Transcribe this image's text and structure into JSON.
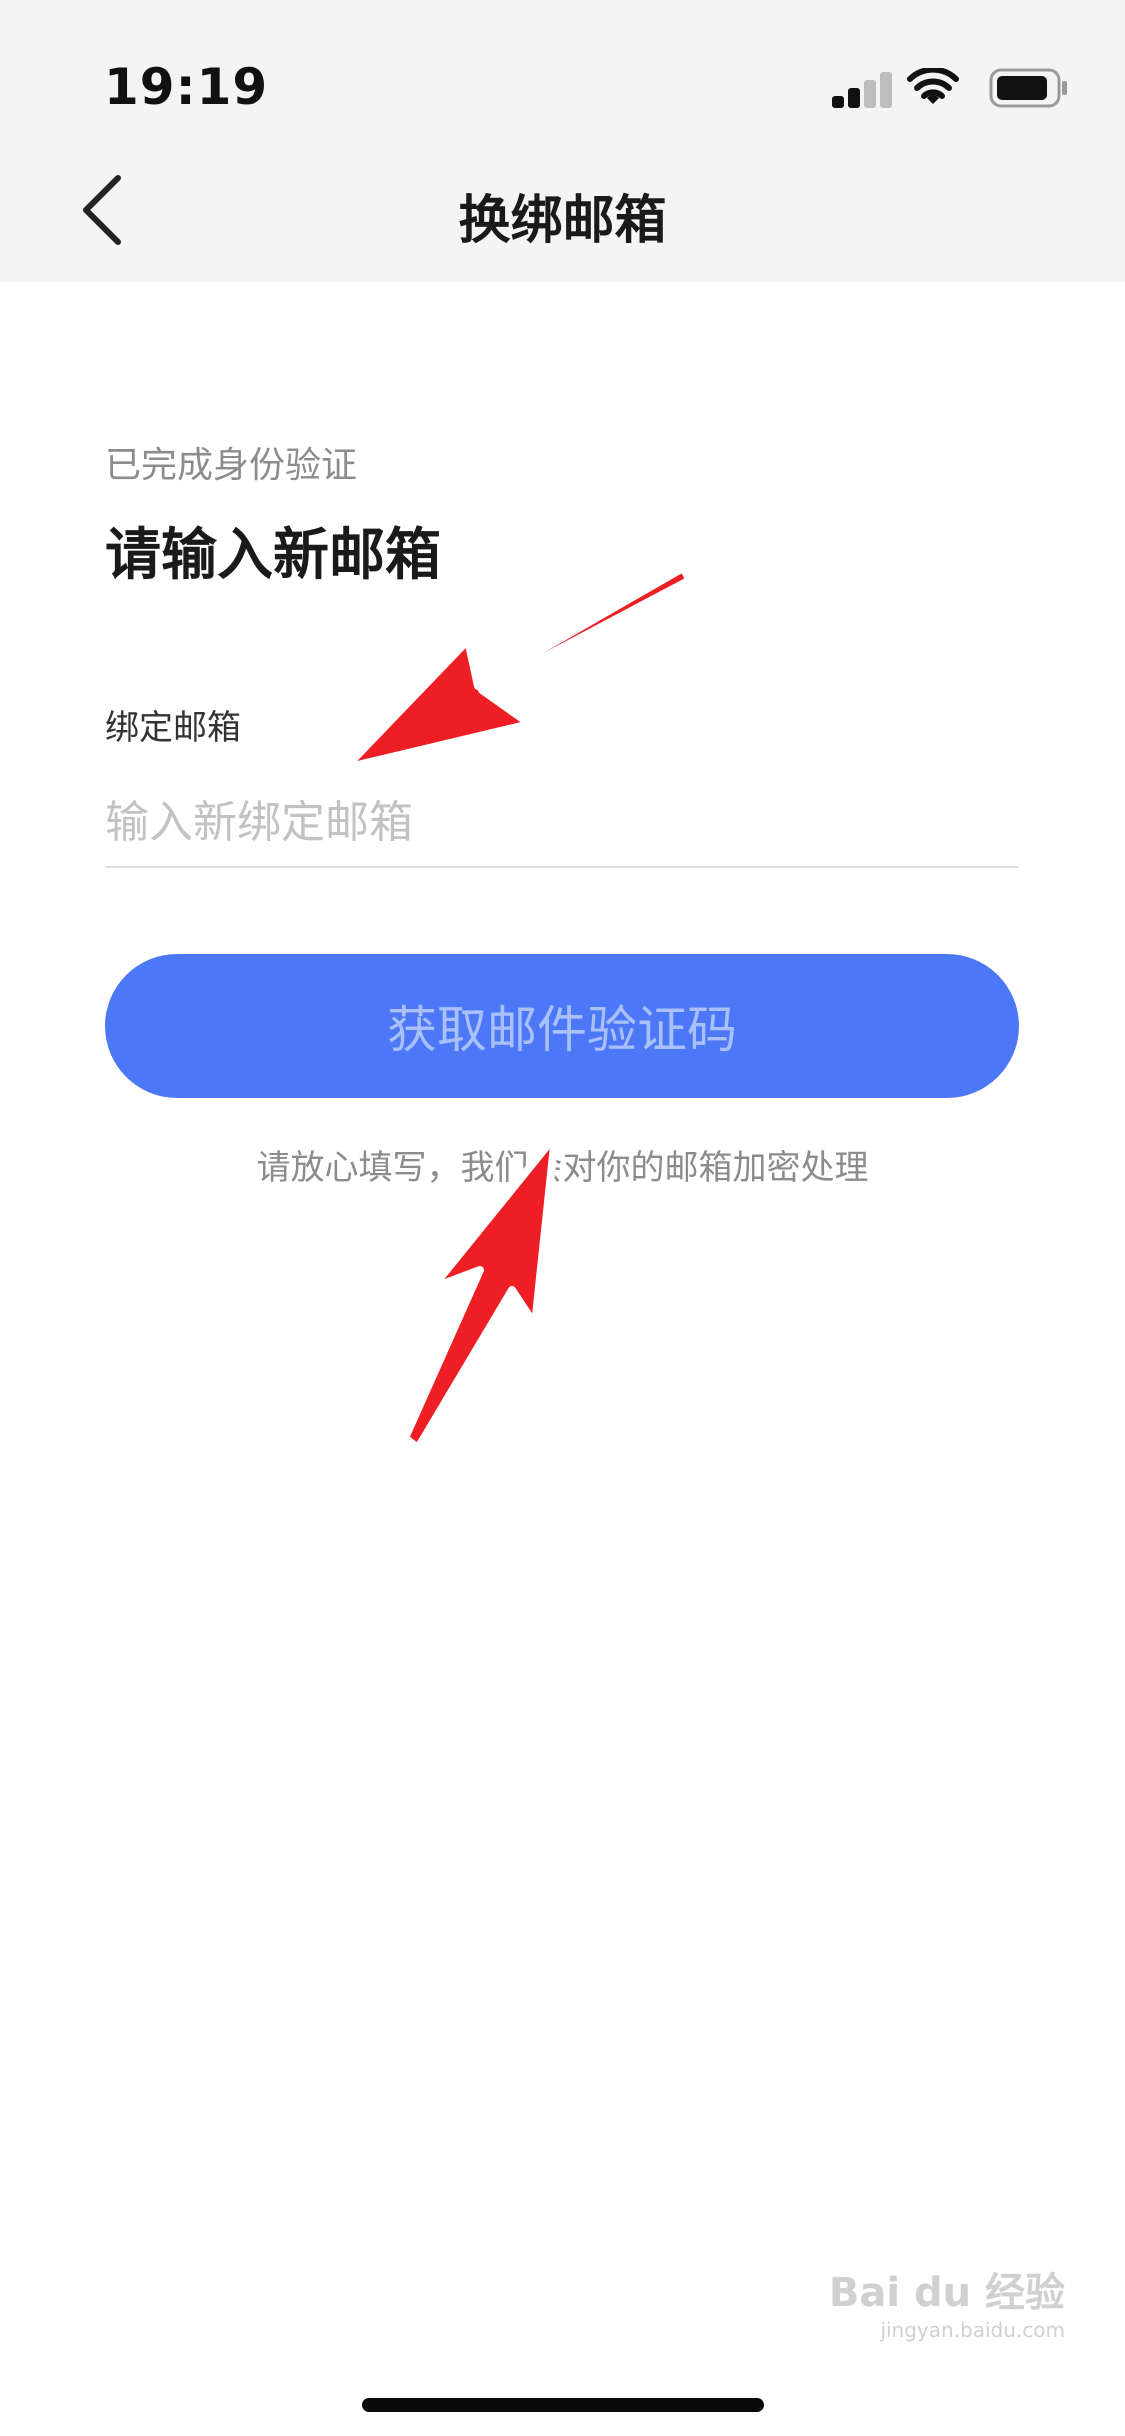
{
  "status_bar": {
    "time": "19:19",
    "icons": [
      "cellular-signal-icon",
      "wifi-icon",
      "battery-icon"
    ]
  },
  "nav": {
    "back_icon": "chevron-left-icon",
    "title": "换绑邮箱"
  },
  "form": {
    "subhead": "已完成身份验证",
    "headline": "请输入新邮箱",
    "field_label": "绑定邮箱",
    "email_value": "",
    "email_placeholder": "输入新绑定邮箱",
    "submit_label": "获取邮件验证码",
    "privacy_note": "请放心填写，我们会对你的邮箱加密处理"
  },
  "annotations": {
    "arrow_color": "#ee1f24"
  },
  "watermark": {
    "text": "Bai du 经验",
    "subtext": "jingyan.baidu.com"
  },
  "colors": {
    "accent": "#4c78f7",
    "button_text": "#a9c0fb",
    "topbar_bg": "#f4f4f4"
  }
}
